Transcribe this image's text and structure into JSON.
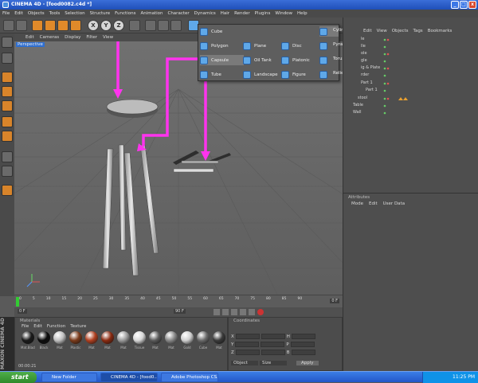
{
  "window": {
    "title": "CINEMA 4D - [food0082.c4d *]",
    "min": "_",
    "max": "□",
    "close": "x"
  },
  "menubar": [
    "File",
    "Edit",
    "Objects",
    "Tools",
    "Selection",
    "Structure",
    "Functions",
    "Animation",
    "Character",
    "Dynamics",
    "Hair",
    "Render",
    "Plugins",
    "Window",
    "Help"
  ],
  "toolbar": {
    "axes": [
      "X",
      "Y",
      "Z"
    ]
  },
  "viewport": {
    "menu": [
      "Edit",
      "Cameras",
      "Display",
      "Filter",
      "View"
    ],
    "label": "Perspective"
  },
  "popup": {
    "items": [
      {
        "label": "Cube"
      },
      {
        "label": "Polygon"
      },
      {
        "label": "Capsule"
      },
      {
        "label": "Tube"
      },
      {
        "label": "Plane"
      },
      {
        "label": "Oil Tank"
      },
      {
        "label": "Landscape"
      },
      {
        "label": "Disc"
      },
      {
        "label": "Platonic"
      },
      {
        "label": "Figure"
      },
      {
        "label": "Cylinder"
      },
      {
        "label": "Pyramid"
      },
      {
        "label": "Torus"
      },
      {
        "label": "Relief"
      }
    ]
  },
  "objects": {
    "menu": [
      "Edit",
      "View",
      "Objects",
      "Tags",
      "Bookmarks"
    ],
    "rows": [
      {
        "name": "le"
      },
      {
        "name": "lle"
      },
      {
        "name": "ole"
      },
      {
        "name": "gle"
      },
      {
        "name": "ig & Plate"
      },
      {
        "name": "rder"
      },
      {
        "name": "Part 1"
      },
      {
        "name": "Part 1"
      },
      {
        "name": "stool"
      },
      {
        "name": "Table"
      },
      {
        "name": "Wall"
      }
    ]
  },
  "attributes": {
    "title": "Attributes",
    "menu": [
      "Mode",
      "Edit",
      "User Data"
    ]
  },
  "timeline": {
    "ticks": [
      "0",
      "5",
      "10",
      "15",
      "20",
      "25",
      "30",
      "35",
      "40",
      "45",
      "50",
      "55",
      "60",
      "65",
      "70",
      "75",
      "80",
      "85",
      "90"
    ],
    "frame_label": "0 F"
  },
  "transport": {
    "start": "0 F",
    "end": "90 F"
  },
  "materials": {
    "title": "Materials",
    "menu": [
      "File",
      "Edit",
      "Function",
      "Texture"
    ],
    "items": [
      {
        "label": "Mat.Black",
        "color": "#1a1a1a"
      },
      {
        "label": "Black",
        "color": "#0c0c0c"
      },
      {
        "label": "Mat",
        "color": "#c0c0c0"
      },
      {
        "label": "Plastic",
        "color": "#7a3a1a"
      },
      {
        "label": "Mat",
        "color": "#b04020"
      },
      {
        "label": "Mat",
        "color": "#8a2a10"
      },
      {
        "label": "Mat",
        "color": "#9a9a9a"
      },
      {
        "label": "Tissue",
        "color": "#d8d8d8"
      },
      {
        "label": "Mat",
        "color": "#5a5a5a"
      },
      {
        "label": "Mat",
        "color": "#888888"
      },
      {
        "label": "Gold",
        "color": "#d0d0d0"
      },
      {
        "label": "Cube",
        "color": "#6a6a6a"
      },
      {
        "label": "Mat",
        "color": "#3a3a3a"
      }
    ],
    "time": "00:00:21"
  },
  "coordinates": {
    "title": "Coordinates",
    "axes": [
      "X",
      "Y",
      "Z"
    ],
    "right_axes": [
      "H",
      "P",
      "B"
    ],
    "mode": "Object",
    "size": "Size",
    "apply": "Apply"
  },
  "taskbar": {
    "start": "start",
    "tasks": [
      "New Folder",
      "CINEMA 4D - [food0...",
      "Adobe Photoshop CS..."
    ],
    "clock": "11:25 PM"
  }
}
